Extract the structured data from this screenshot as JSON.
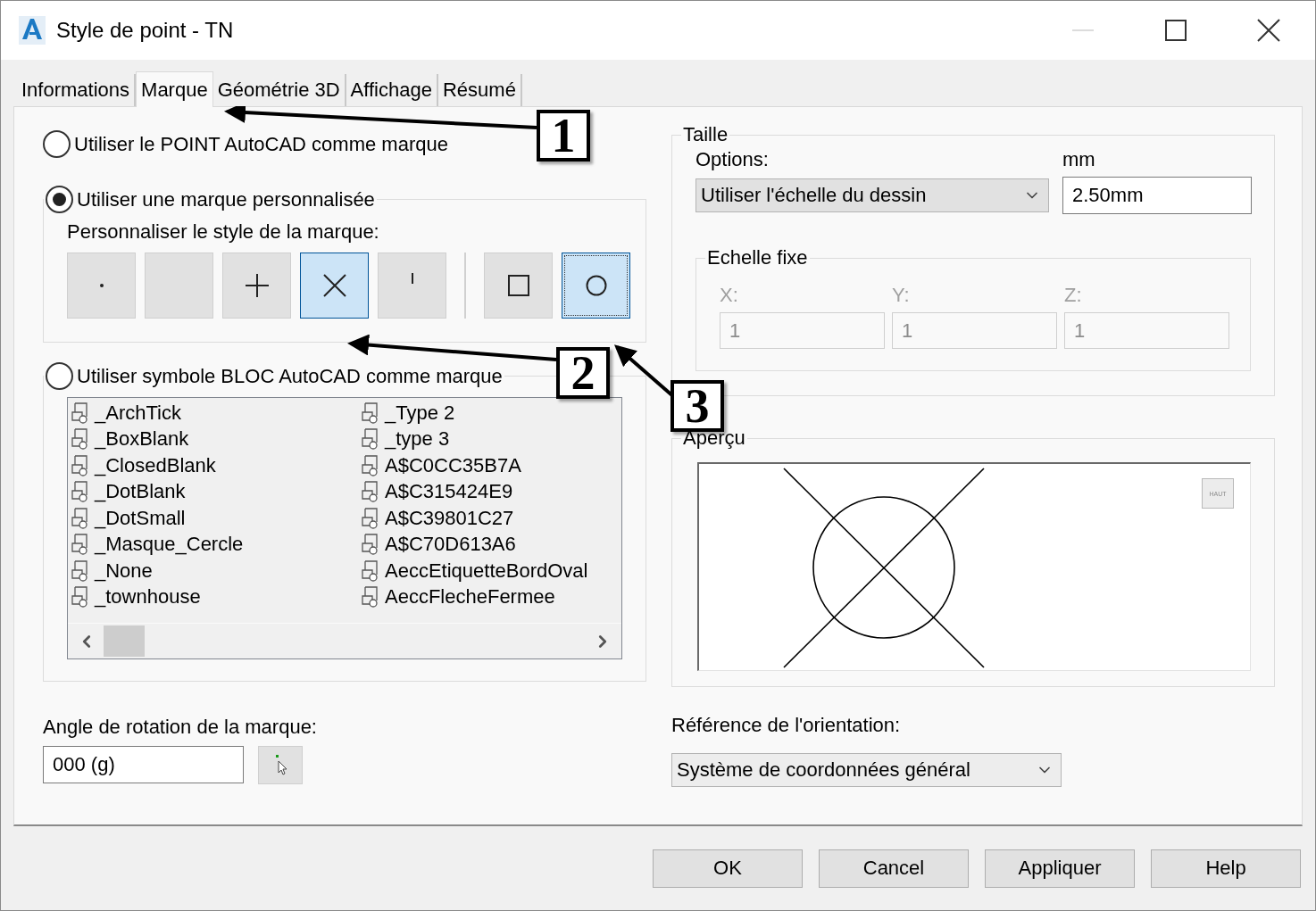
{
  "window": {
    "title": "Style de point - TN"
  },
  "tabs": [
    {
      "label": "Informations",
      "selected": false
    },
    {
      "label": "Marque",
      "selected": true
    },
    {
      "label": "Géométrie 3D",
      "selected": false
    },
    {
      "label": "Affichage",
      "selected": false
    },
    {
      "label": "Résumé",
      "selected": false
    }
  ],
  "marker": {
    "options": [
      {
        "label": "Utiliser le POINT AutoCAD comme marque",
        "selected": false
      },
      {
        "label": "Utiliser une marque personnalisée",
        "selected": true
      },
      {
        "label": "Utiliser symbole BLOC AutoCAD comme marque",
        "selected": false
      }
    ],
    "custom_style": {
      "label": "Personnaliser le style de la marque:",
      "shapes": [
        {
          "kind": "dot",
          "selected": false
        },
        {
          "kind": "none",
          "selected": false
        },
        {
          "kind": "plus",
          "selected": false
        },
        {
          "kind": "cross",
          "selected": true
        },
        {
          "kind": "tick",
          "selected": false
        }
      ],
      "frames": [
        {
          "kind": "square",
          "selected": false
        },
        {
          "kind": "circle",
          "selected": true
        }
      ]
    },
    "blocks": [
      [
        "_ArchTick",
        "_BoxBlank",
        "_ClosedBlank",
        "_DotBlank",
        "_DotSmall",
        "_Masque_Cercle",
        "_None",
        "_townhouse"
      ],
      [
        "_Type 2",
        "_type 3",
        "A$C0CC35B7A",
        "A$C315424E9",
        "A$C39801C27",
        "A$C70D613A6",
        "AeccEtiquetteBordOval",
        "AeccFlecheFermee"
      ]
    ],
    "rotation": {
      "label": "Angle de rotation de la marque:",
      "value": "000 (g)"
    }
  },
  "size": {
    "title": "Taille",
    "options_label": "Options:",
    "option": "Utiliser l'échelle du dessin",
    "unit_label": "mm",
    "value": "2.50mm",
    "fixed_scale": {
      "title": "Echelle fixe",
      "disabled": true,
      "axes": [
        {
          "label": "X:",
          "value": "1"
        },
        {
          "label": "Y:",
          "value": "1"
        },
        {
          "label": "Z:",
          "value": "1"
        }
      ]
    }
  },
  "preview": {
    "title": "Aperçu",
    "badge": "HAUT"
  },
  "orientation": {
    "label": "Référence de l'orientation:",
    "value": "Système de coordonnées général"
  },
  "buttons": [
    "OK",
    "Cancel",
    "Appliquer",
    "Help"
  ],
  "callouts": [
    "1",
    "2",
    "3"
  ]
}
